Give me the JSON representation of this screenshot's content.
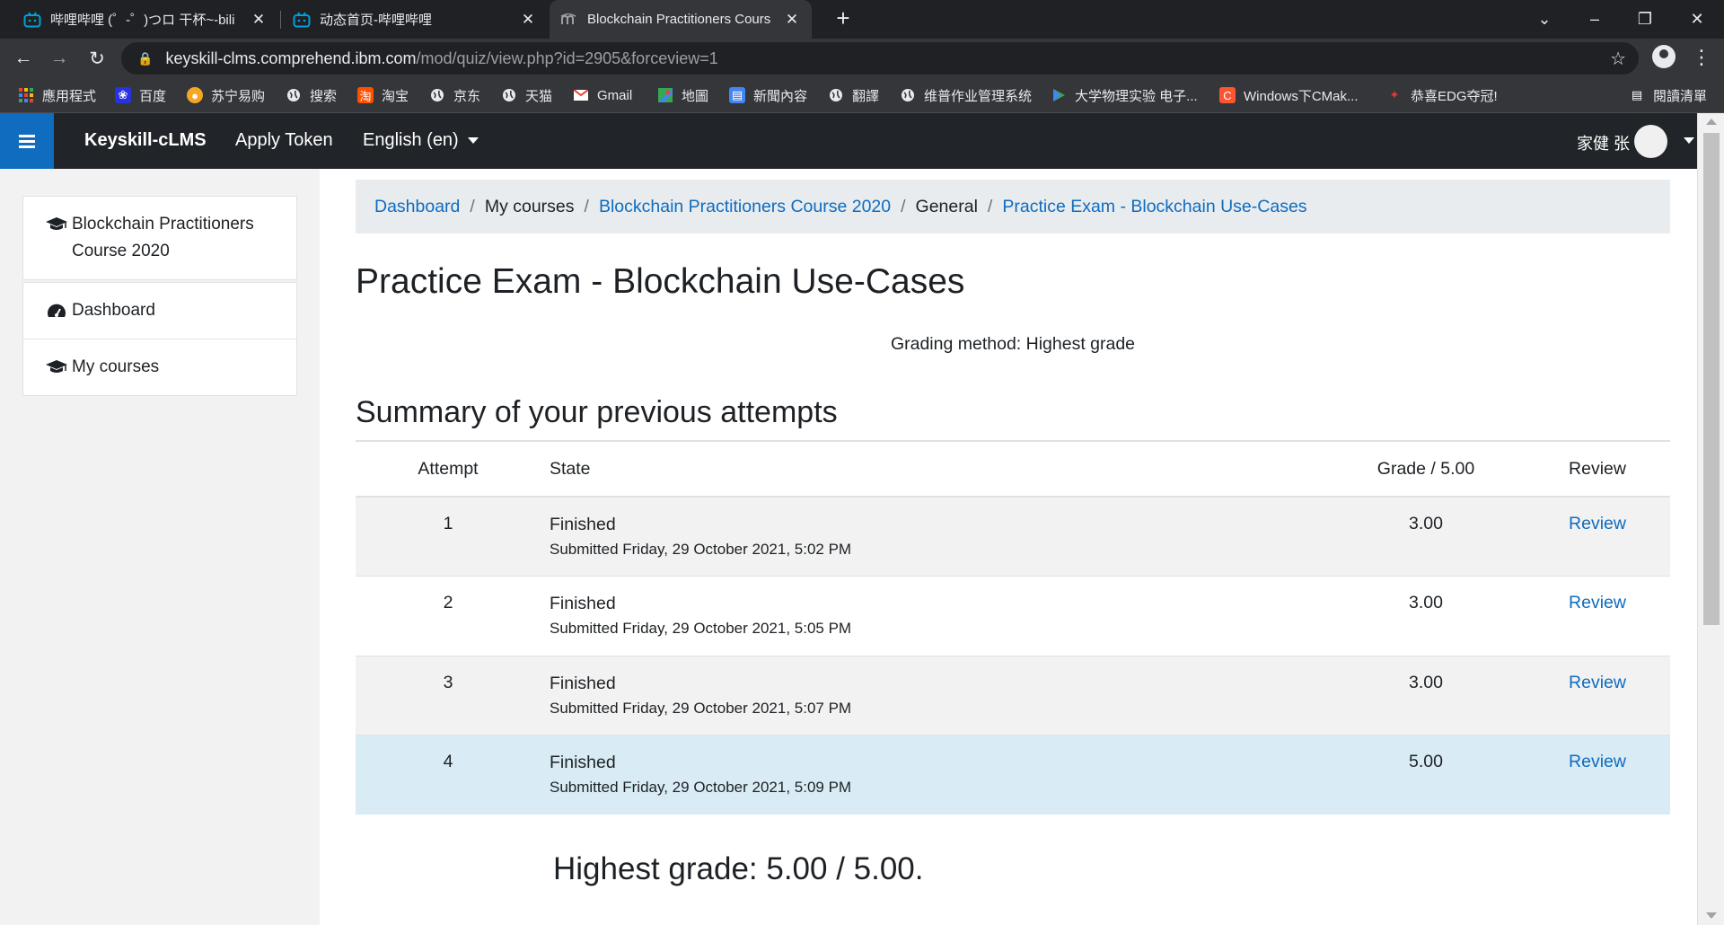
{
  "browser": {
    "tabs": [
      {
        "title": "哔哩哔哩 (゜-゜)つロ 干杯~-bili",
        "icon": "bilibili-icon"
      },
      {
        "title": "动态首页-哔哩哔哩",
        "icon": "bilibili-icon"
      },
      {
        "title": "Blockchain Practitioners Cours",
        "icon": "moodle-icon"
      }
    ],
    "url_host": "keyskill-clms.comprehend.ibm.com",
    "url_path": "/mod/quiz/view.php?id=2905&forceview=1",
    "bookmarks": [
      {
        "label": "應用程式",
        "icon": "apps-grid-icon"
      },
      {
        "label": "百度",
        "icon": "baidu-icon"
      },
      {
        "label": "苏宁易购",
        "icon": "suning-icon"
      },
      {
        "label": "搜索",
        "icon": "globe-icon"
      },
      {
        "label": "淘宝",
        "icon": "taobao-icon"
      },
      {
        "label": "京东",
        "icon": "globe-icon"
      },
      {
        "label": "天猫",
        "icon": "globe-icon"
      },
      {
        "label": "Gmail",
        "icon": "gmail-icon"
      },
      {
        "label": "地圖",
        "icon": "maps-icon"
      },
      {
        "label": "新聞內容",
        "icon": "news-icon"
      },
      {
        "label": "翻譯",
        "icon": "globe-icon"
      },
      {
        "label": "维普作业管理系统",
        "icon": "globe-icon"
      },
      {
        "label": "大学物理实验 电子...",
        "icon": "play-icon"
      },
      {
        "label": "Windows下CMak...",
        "icon": "csdn-icon"
      },
      {
        "label": "恭喜EDG夺冠!",
        "icon": "edg-icon"
      }
    ],
    "reading_list": "閱讀清單"
  },
  "navbar": {
    "brand": "Keyskill-cLMS",
    "apply_token": "Apply Token",
    "language": "English (en)",
    "username": "家健 张"
  },
  "drawer": {
    "course": "Blockchain Practitioners Course 2020",
    "dashboard": "Dashboard",
    "my_courses": "My courses"
  },
  "breadcrumb": {
    "dashboard": "Dashboard",
    "my_courses": "My courses",
    "course": "Blockchain Practitioners Course 2020",
    "general": "General",
    "quiz": "Practice Exam - Blockchain Use-Cases"
  },
  "page": {
    "title": "Practice Exam - Blockchain Use-Cases",
    "grading_method": "Grading method: Highest grade",
    "summary_heading": "Summary of your previous attempts",
    "highest_grade": "Highest grade: 5.00 / 5.00."
  },
  "table": {
    "headers": {
      "attempt": "Attempt",
      "state": "State",
      "grade": "Grade / 5.00",
      "review": "Review"
    },
    "rows": [
      {
        "attempt": "1",
        "state": "Finished",
        "submitted": "Submitted Friday, 29 October 2021, 5:02 PM",
        "grade": "3.00",
        "review": "Review"
      },
      {
        "attempt": "2",
        "state": "Finished",
        "submitted": "Submitted Friday, 29 October 2021, 5:05 PM",
        "grade": "3.00",
        "review": "Review"
      },
      {
        "attempt": "3",
        "state": "Finished",
        "submitted": "Submitted Friday, 29 October 2021, 5:07 PM",
        "grade": "3.00",
        "review": "Review"
      },
      {
        "attempt": "4",
        "state": "Finished",
        "submitted": "Submitted Friday, 29 October 2021, 5:09 PM",
        "grade": "5.00",
        "review": "Review"
      }
    ]
  },
  "colors": {
    "accent": "#0f6cbf",
    "navbar": "#212529",
    "highlight_row": "#d9ecf5"
  }
}
